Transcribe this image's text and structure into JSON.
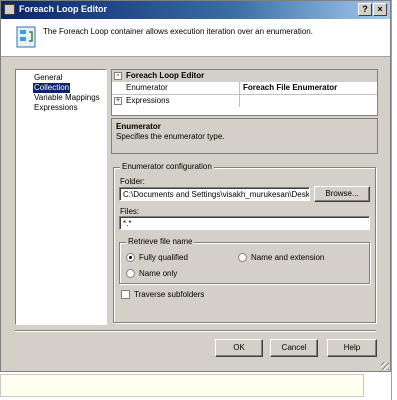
{
  "window": {
    "title": "Foreach Loop Editor",
    "description": "The Foreach Loop container allows execution iteration over an enumeration."
  },
  "nav": {
    "items": [
      {
        "label": "General"
      },
      {
        "label": "Collection"
      },
      {
        "label": "Variable Mappings"
      },
      {
        "label": "Expressions"
      }
    ],
    "selected": "Collection"
  },
  "property_grid": {
    "category": "Foreach Loop Editor",
    "category_toggle": "⊟",
    "rows": [
      {
        "name": "Enumerator",
        "value": "Foreach File Enumerator"
      },
      {
        "name": "Expressions",
        "value": "",
        "toggle": "⊞"
      }
    ]
  },
  "description_panel": {
    "title": "Enumerator",
    "text": "Specifies the enumerator type."
  },
  "config": {
    "legend": "Enumerator configuration",
    "folder_label": "Folder:",
    "folder_value": "C:\\Documents and Settings\\visakh_murukesan\\Desktc",
    "browse_label": "Browse...",
    "files_label": "Files:",
    "files_value": "*.*",
    "retrieve_legend": "Retrieve file name",
    "options": [
      {
        "label": "Fully qualified",
        "selected": true
      },
      {
        "label": "Name and extension",
        "selected": false
      },
      {
        "label": "Name only",
        "selected": false
      }
    ],
    "traverse_label": "Traverse subfolders",
    "traverse_checked": false
  },
  "footer": {
    "ok": "OK",
    "cancel": "Cancel",
    "help": "Help"
  }
}
